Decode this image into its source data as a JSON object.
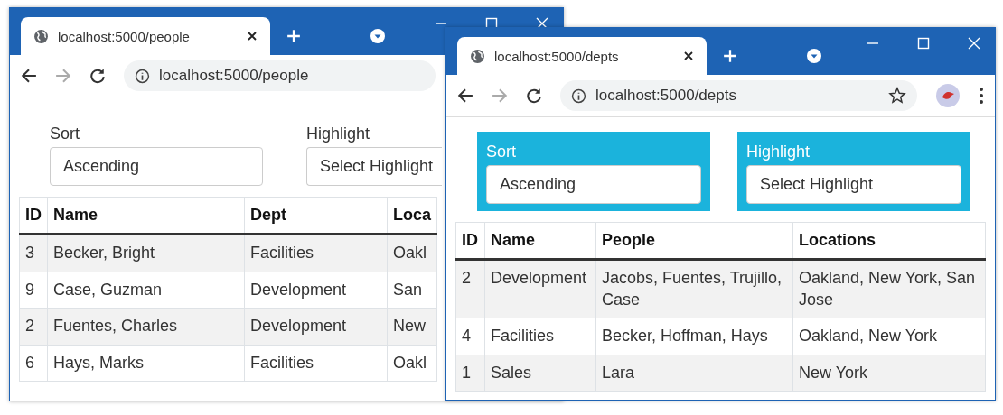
{
  "windows": [
    {
      "tab_title": "localhost:5000/people",
      "url": "localhost:5000/people",
      "controls": [
        {
          "label": "Sort",
          "value": "Ascending",
          "highlighted": false
        },
        {
          "label": "Highlight",
          "value": "Select Highlight",
          "highlighted": false
        }
      ],
      "table": {
        "columns": [
          "ID",
          "Name",
          "Dept",
          "Loca"
        ],
        "rows": [
          [
            "3",
            "Becker, Bright",
            "Facilities",
            "Oakl"
          ],
          [
            "9",
            "Case, Guzman",
            "Development",
            "San"
          ],
          [
            "2",
            "Fuentes, Charles",
            "Development",
            "New"
          ],
          [
            "6",
            "Hays, Marks",
            "Facilities",
            "Oakl"
          ]
        ]
      }
    },
    {
      "tab_title": "localhost:5000/depts",
      "url": "localhost:5000/depts",
      "controls": [
        {
          "label": "Sort",
          "value": "Ascending",
          "highlighted": true
        },
        {
          "label": "Highlight",
          "value": "Select Highlight",
          "highlighted": true
        }
      ],
      "table": {
        "columns": [
          "ID",
          "Name",
          "People",
          "Locations"
        ],
        "rows": [
          [
            "2",
            "Development",
            "Jacobs, Fuentes, Trujillo, Case",
            "Oakland, New York, San Jose"
          ],
          [
            "4",
            "Facilities",
            "Becker, Hoffman, Hays",
            "Oakland, New York"
          ],
          [
            "1",
            "Sales",
            "Lara",
            "New York"
          ]
        ]
      }
    }
  ]
}
